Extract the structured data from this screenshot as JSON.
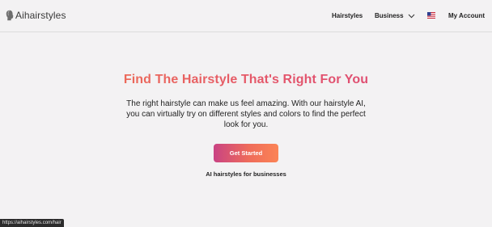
{
  "brand": {
    "name": "Aihairstyles",
    "icon": "head-silhouette-icon"
  },
  "nav": {
    "hairstyles_label": "Hairstyles",
    "business_label": "Business",
    "business_icon": "chevron-down-icon",
    "language_icon": "us-flag-icon",
    "account_label": "My Account"
  },
  "hero": {
    "title": "Find The Hairstyle That's Right For You",
    "description": "The right hairstyle can make us feel amazing. With our hairstyle AI, you can virtually try on different styles and colors to find the perfect look for you.",
    "cta_label": "Get Started",
    "business_link": "AI hairstyles for businesses"
  },
  "status_bar": {
    "url": "https://aihairstyles.com/hair"
  },
  "colors": {
    "background": "#f3f2f3",
    "accent_start": "#c94383",
    "accent_end": "#fb8455"
  }
}
